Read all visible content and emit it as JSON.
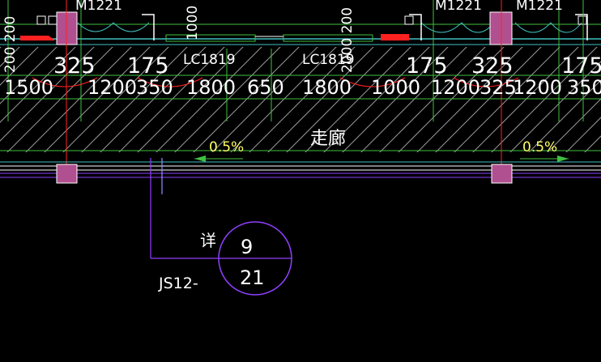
{
  "door_labels": [
    "M1221",
    "M1221",
    "M1221"
  ],
  "window_labels": [
    "LC1819",
    "LC1819"
  ],
  "vertical_dims": [
    "200 200",
    "1000",
    "2000 200"
  ],
  "dim_row_top": [
    "325",
    "175",
    "175",
    "325",
    "175"
  ],
  "dim_row_main": [
    "1500",
    "1200",
    "350",
    "1800",
    "650",
    "1800",
    "1000",
    "1200",
    "325",
    "1200",
    "350"
  ],
  "corridor_label": "走廊",
  "slope_labels": [
    "0.5%",
    "0.5%"
  ],
  "detail_prefix": "详",
  "detail_number": "9",
  "detail_sheet": "21",
  "drawing_ref": "JS12-",
  "colors": {
    "background": "#000000",
    "wall_hatch": "#bfbfbf",
    "axis_red": "#ff2020",
    "column_magenta": "#b05090",
    "green": "#40c040",
    "cyan": "#40c0c0",
    "purple": "#9040ff",
    "yellow": "#ffff66"
  }
}
